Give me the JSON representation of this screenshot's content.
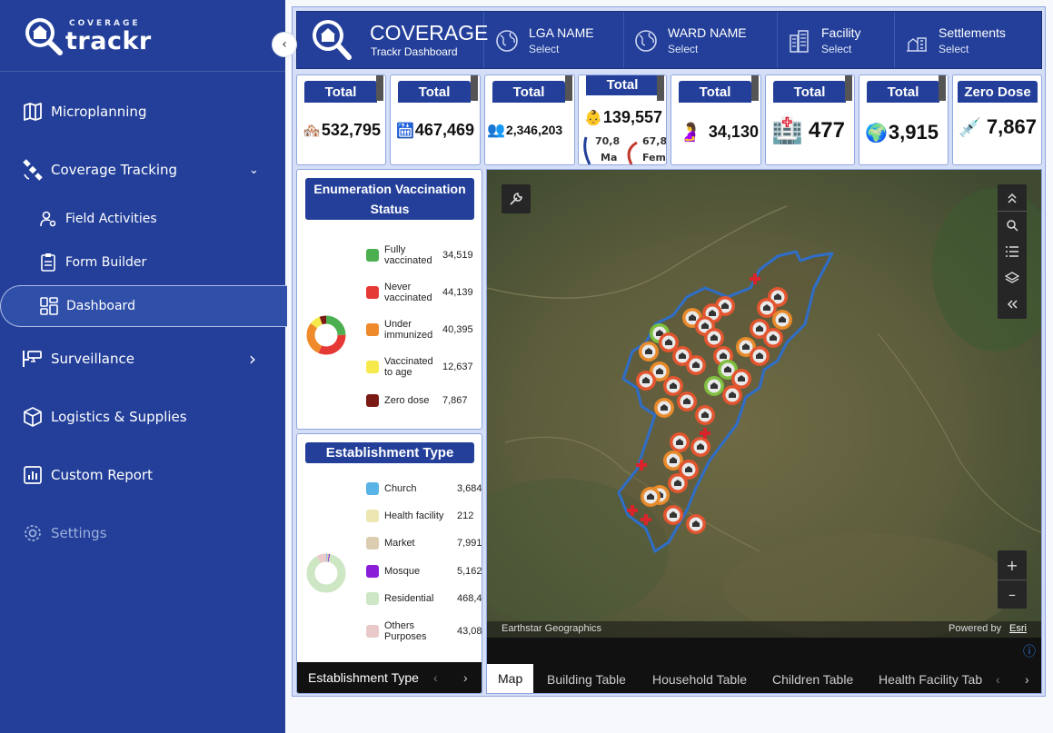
{
  "sidebar": {
    "logo_small": "COVERAGE",
    "logo_big": "trackr",
    "collapse_icon": "‹",
    "items": [
      {
        "label": "Microplanning",
        "icon": "map-icon"
      },
      {
        "label": "Coverage Tracking",
        "icon": "satellite-icon",
        "chevron": "⌄"
      },
      {
        "label": "Field Activities",
        "icon": "user-settings-icon"
      },
      {
        "label": "Form Builder",
        "icon": "clipboard-icon"
      },
      {
        "label": "Dashboard",
        "icon": "dashboard-icon"
      },
      {
        "label": "Surveillance",
        "icon": "cctv-icon",
        "chevron": "›"
      },
      {
        "label": "Logistics & Supplies",
        "icon": "package-icon"
      },
      {
        "label": "Custom Report",
        "icon": "report-icon"
      },
      {
        "label": "Settings",
        "icon": "gear-icon"
      }
    ]
  },
  "header": {
    "title": "COVERAGE",
    "subtitle": "Trackr Dashboard",
    "filters": [
      {
        "name": "LGA NAME",
        "value": "Select",
        "icon": "globe-icon"
      },
      {
        "name": "WARD NAME",
        "value": "Select",
        "icon": "globe-icon"
      },
      {
        "name": "Facility",
        "value": "Select",
        "icon": "buildings-icon"
      },
      {
        "name": "Settlements",
        "value": "Select",
        "icon": "settlement-icon"
      }
    ]
  },
  "stats": [
    {
      "label": "Total",
      "value": "532,795",
      "emoji": "🏘️"
    },
    {
      "label": "Total",
      "value": "467,469",
      "emoji": "🛗"
    },
    {
      "label": "Total",
      "value": "2,346,203",
      "emoji": "👥"
    },
    {
      "label": "Total",
      "value": "139,557",
      "emoji": "👶"
    },
    {
      "label": "Total",
      "value": "34,130",
      "emoji": "🤰"
    },
    {
      "label": "Total",
      "value": "477",
      "emoji": "🏥"
    },
    {
      "label": "Total",
      "value": "3,915",
      "emoji": "🌍"
    },
    {
      "label": "Zero Dose",
      "value": "7,867",
      "emoji": "💉"
    }
  ],
  "stat4_overflow": {
    "left": "70,8",
    "right": "67,8",
    "bottom_left": "Ma",
    "bottom_right": "Fem"
  },
  "vaccination_panel": {
    "title": "Enumeration Vaccination Status",
    "items": [
      {
        "label": "Fully vaccinated",
        "value": "34,519",
        "color": "#4caf50",
        "share": 0.249
      },
      {
        "label": "Never vaccinated",
        "value": "44,139",
        "color": "#e53935",
        "share": 0.318
      },
      {
        "label": "Under immunized",
        "value": "40,395",
        "color": "#ef8a2b",
        "share": 0.291
      },
      {
        "label": "Vaccinated to age",
        "value": "12,637",
        "color": "#f5e94b",
        "share": 0.091
      },
      {
        "label": "Zero dose",
        "value": "7,867",
        "color": "#7b1a14",
        "share": 0.057
      }
    ]
  },
  "establishment_panel": {
    "title": "Establishment Type",
    "items": [
      {
        "label": "Church",
        "value": "3,684",
        "color": "#58b3e6",
        "share": 0.0069
      },
      {
        "label": "Health facility",
        "value": "212",
        "color": "#ece7b1",
        "share": 0.0004
      },
      {
        "label": "Market",
        "value": "7,991",
        "color": "#dccdb0",
        "share": 0.015
      },
      {
        "label": "Mosque",
        "value": "5,162",
        "color": "#8a1ed8",
        "share": 0.0097
      },
      {
        "label": "Residential",
        "value": "468,4",
        "color": "#cde6c4",
        "share": 0.88
      },
      {
        "label": "Others Purposes",
        "value": "43,08",
        "color": "#e9c9c9",
        "share": 0.081
      }
    ]
  },
  "left_tabs": {
    "active": "Establishment Type",
    "prev": "‹",
    "next": "›"
  },
  "map": {
    "attribution": "Earthstar Geographics",
    "powered_by": "Powered by",
    "powered_link": "Esri",
    "tabs": [
      "Map",
      "Building Table",
      "Household Table",
      "Children Table",
      "Health Facility Tab"
    ],
    "prev": "‹",
    "next": "›",
    "zoom_in": "+",
    "zoom_out": "–",
    "info": "ⓘ"
  }
}
